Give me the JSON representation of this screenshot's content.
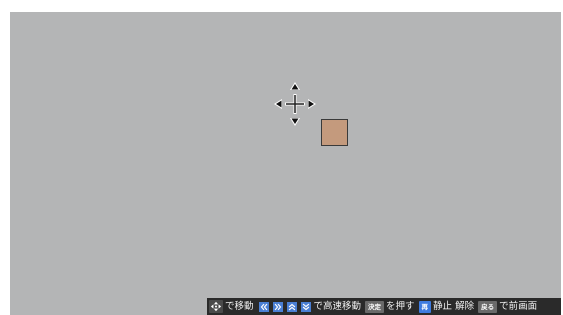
{
  "screen": {
    "background_color": "#b4b5b6",
    "cursor": {
      "icon": "move-crosshair-icon"
    },
    "swatch": {
      "color": "#c49a7d"
    }
  },
  "help_bar": {
    "background_color": "#2a2a2a",
    "dpad": {
      "icon": "dpad-icon"
    },
    "move_text": "で移動",
    "fast_keys": [
      {
        "icon": "double-chevron-left-icon",
        "color": "#4a7fd4"
      },
      {
        "icon": "double-chevron-right-icon",
        "color": "#4a7fd4"
      },
      {
        "icon": "double-chevron-up-icon",
        "color": "#4a7fd4"
      },
      {
        "icon": "double-chevron-down-icon",
        "color": "#4a7fd4"
      }
    ],
    "fast_move_text": "で高速移動",
    "enter_key": {
      "label": "決定",
      "color": "#6a6a6a"
    },
    "press_text": "を押す",
    "play_key": {
      "label": "再",
      "color": "#3e7be0"
    },
    "pause_text": "静止 解除",
    "back_key": {
      "label": "戻る",
      "color": "#6a6a6a"
    },
    "back_text": "で前画面"
  }
}
